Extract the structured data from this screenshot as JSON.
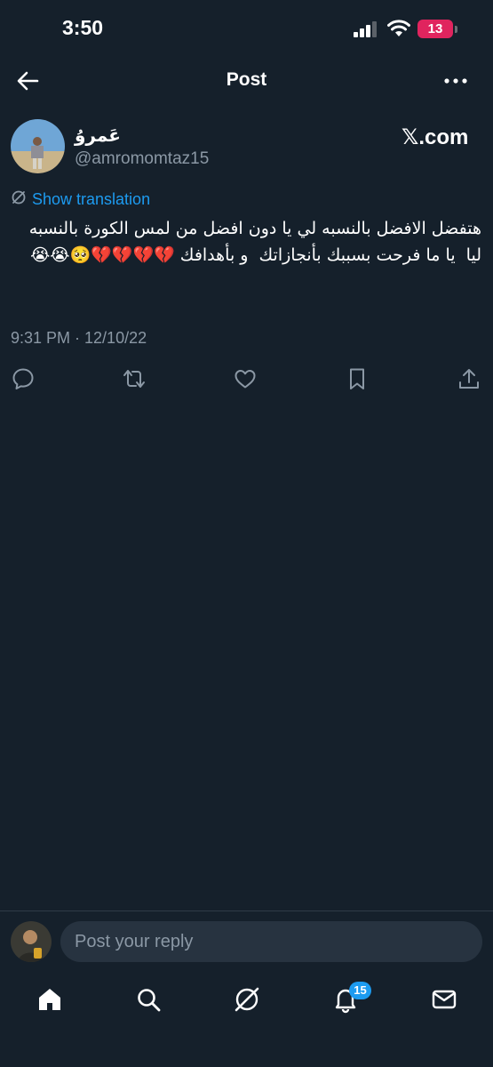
{
  "status_bar": {
    "time": "3:50",
    "battery_level": "13",
    "icons": [
      "cellular-signal-icon",
      "wifi-icon",
      "battery-icon"
    ]
  },
  "header": {
    "title": "Post",
    "icons": [
      "back-arrow-icon",
      "more-options-icon"
    ]
  },
  "post": {
    "author": {
      "display_name": "عَمروُ",
      "handle": "@amromomtaz15"
    },
    "source_label": "𝕏.com",
    "translation_label": "Show translation",
    "text": "هتفضل الافضل بالنسبه لي يا دون افضل من لمس الكورة بالنسبه ليا  يا ما فرحت بسببك بأنجازاتك  و بأهدافك 💔💔💔💔🥺😭😭",
    "timestamp": "9:31 PM · 12/10/22",
    "actions": [
      "reply-icon",
      "retweet-icon",
      "like-icon",
      "bookmark-icon",
      "share-icon"
    ]
  },
  "reply": {
    "placeholder": "Post your reply"
  },
  "tabbar": {
    "items": [
      "home-icon",
      "search-icon",
      "grok-icon",
      "notifications-icon",
      "messages-icon"
    ],
    "notifications_badge": "15"
  },
  "colors": {
    "background": "#15202b",
    "accent": "#1d9bf0",
    "secondary_text": "#8b98a5",
    "battery_low": "#e0245e"
  }
}
